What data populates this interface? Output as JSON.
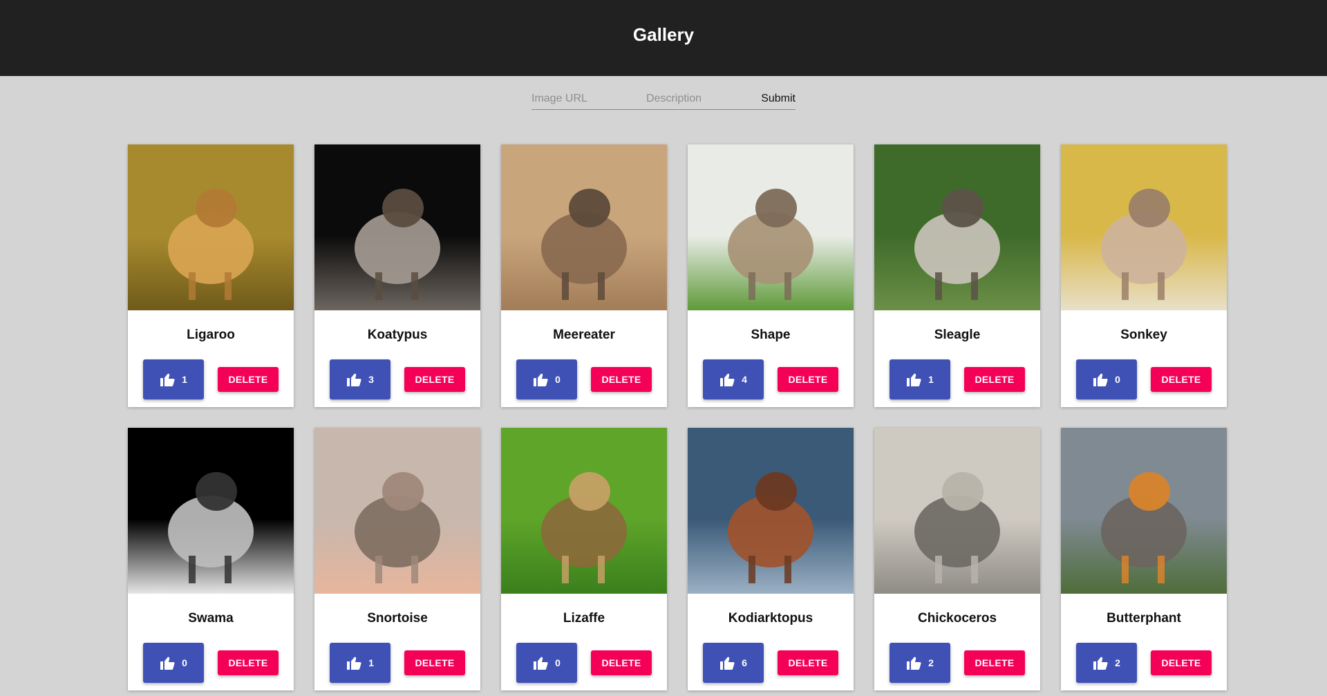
{
  "header": {
    "title": "Gallery"
  },
  "form": {
    "url_placeholder": "Image URL",
    "description_placeholder": "Description",
    "submit_label": "Submit"
  },
  "colors": {
    "header_bg": "#212121",
    "page_bg": "#d4d4d4",
    "like_button": "#3f51b5",
    "delete_button": "#f50057"
  },
  "delete_label": "DELETE",
  "like_icon": "thumb-up-icon",
  "cards": [
    {
      "name": "Ligaroo",
      "likes": "1",
      "palette": [
        "#a88a2e",
        "#6f5a1a",
        "#d9a552",
        "#b27a35"
      ]
    },
    {
      "name": "Koatypus",
      "likes": "3",
      "palette": [
        "#0b0b0b",
        "#6d6660",
        "#a39a91",
        "#5b4c3f"
      ]
    },
    {
      "name": "Meereater",
      "likes": "0",
      "palette": [
        "#c9a57c",
        "#a27d58",
        "#8a6a4f",
        "#5e4a3a"
      ]
    },
    {
      "name": "Shape",
      "likes": "4",
      "palette": [
        "#e9ece6",
        "#5f9a3a",
        "#a89276",
        "#7d6c58"
      ]
    },
    {
      "name": "Sleagle",
      "likes": "1",
      "palette": [
        "#3f6b2a",
        "#6b8f47",
        "#c8c2b8",
        "#5c5248"
      ]
    },
    {
      "name": "Sonkey",
      "likes": "0",
      "palette": [
        "#d9b84a",
        "#e8dfc8",
        "#cdb39b",
        "#9b8068"
      ]
    },
    {
      "name": "Swama",
      "likes": "0",
      "palette": [
        "#000000",
        "#e6e6e6",
        "#bdbdbd",
        "#333333"
      ]
    },
    {
      "name": "Snortoise",
      "likes": "1",
      "palette": [
        "#c7b7ad",
        "#e7b69c",
        "#7f6e62",
        "#a0887a"
      ]
    },
    {
      "name": "Lizaffe",
      "likes": "0",
      "palette": [
        "#5ea52a",
        "#3b7f1c",
        "#8a6a3a",
        "#c4a064"
      ]
    },
    {
      "name": "Kodiarktopus",
      "likes": "6",
      "palette": [
        "#3b5a78",
        "#9bb0c4",
        "#a0522d",
        "#6b3a22"
      ]
    },
    {
      "name": "Chickoceros",
      "likes": "2",
      "palette": [
        "#cfcac1",
        "#8f8c86",
        "#6e6b65",
        "#b8b3aa"
      ]
    },
    {
      "name": "Butterphant",
      "likes": "2",
      "palette": [
        "#7f8a92",
        "#4f6d3a",
        "#6b6560",
        "#d9842b"
      ]
    }
  ]
}
